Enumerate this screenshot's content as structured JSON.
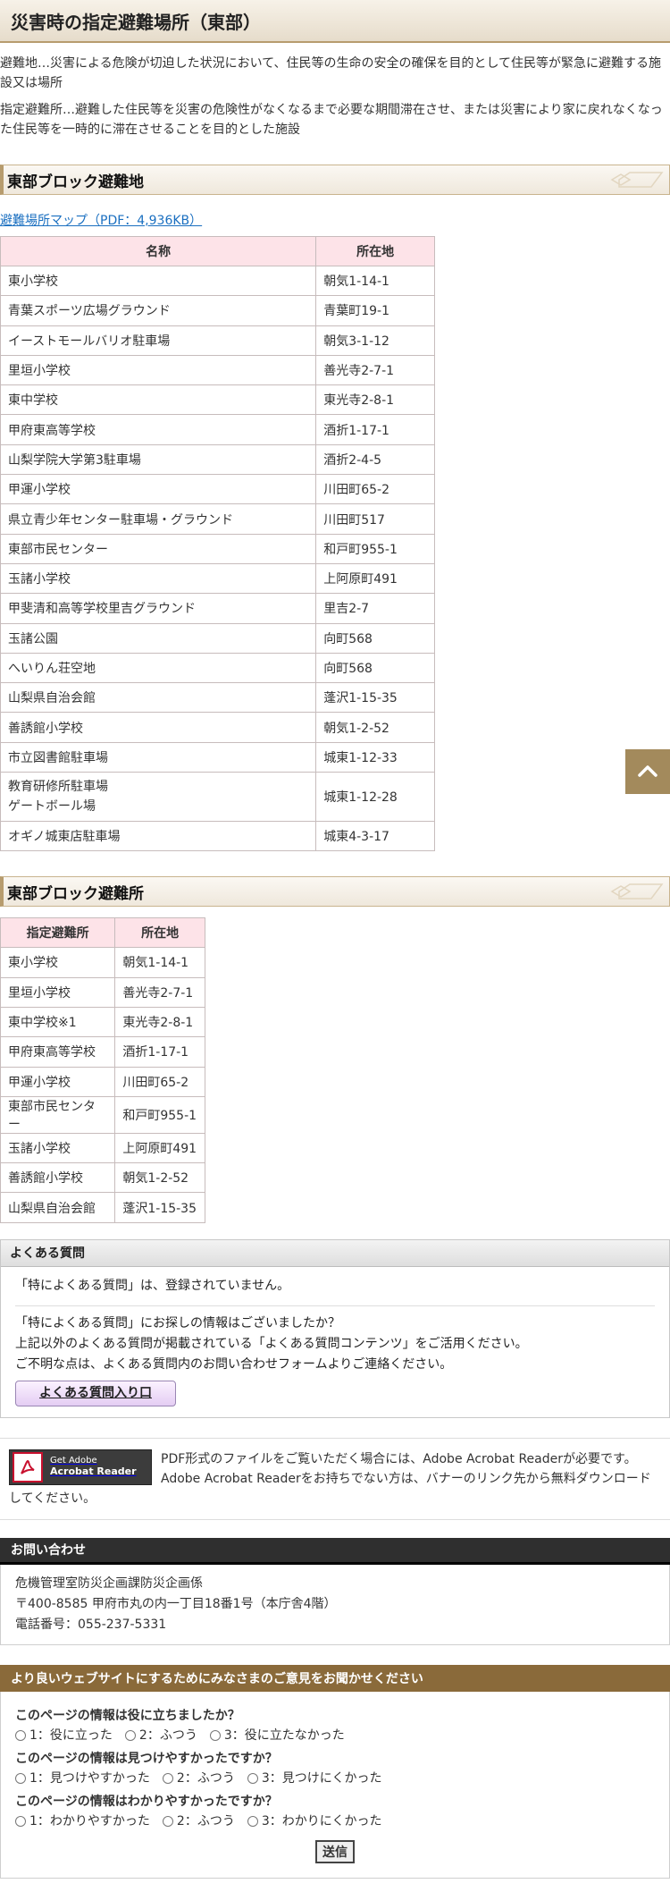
{
  "page": {
    "title": "災害時の指定避難場所（東部）",
    "intro": [
      "避難地…災害による危険が切迫した状況において、住民等の生命の安全の確保を目的として住民等が緊急に避難する施設又は場所",
      "指定避難所…避難した住民等を災害の危険性がなくなるまで必要な期間滞在させ、または災害により家に戻れなくなった住民等を一時的に滞在させることを目的とした施設"
    ]
  },
  "section1": {
    "heading": "東部ブロック避難地",
    "map_link": "避難場所マップ（PDF：4,936KB）",
    "headers": [
      "名称",
      "所在地"
    ],
    "rows": [
      [
        "東小学校",
        "朝気1-14-1"
      ],
      [
        "青葉スポーツ広場グラウンド",
        "青葉町19-1"
      ],
      [
        "イーストモールバリオ駐車場",
        "朝気3-1-12"
      ],
      [
        "里垣小学校",
        "善光寺2-7-1"
      ],
      [
        "東中学校",
        "東光寺2-8-1"
      ],
      [
        "甲府東高等学校",
        "酒折1-17-1"
      ],
      [
        "山梨学院大学第3駐車場",
        "酒折2-4-5"
      ],
      [
        "甲運小学校",
        "川田町65-2"
      ],
      [
        "県立青少年センター駐車場・グラウンド",
        "川田町517"
      ],
      [
        "東部市民センター",
        "和戸町955-1"
      ],
      [
        "玉諸小学校",
        "上阿原町491"
      ],
      [
        "甲斐清和高等学校里吉グラウンド",
        "里吉2-7"
      ],
      [
        "玉諸公園",
        "向町568"
      ],
      [
        "へいりん荘空地",
        "向町568"
      ],
      [
        "山梨県自治会館",
        "蓬沢1-15-35"
      ],
      [
        "善誘館小学校",
        "朝気1-2-52"
      ],
      [
        "市立図書館駐車場",
        "城東1-12-33"
      ],
      [
        "教育研修所駐車場\nゲートボール場",
        "城東1-12-28"
      ],
      [
        "オギノ城東店駐車場",
        "城東4-3-17"
      ]
    ]
  },
  "section2": {
    "heading": "東部ブロック避難所",
    "headers": [
      "指定避難所",
      "所在地"
    ],
    "rows": [
      [
        "東小学校",
        "朝気1-14-1"
      ],
      [
        "里垣小学校",
        "善光寺2-7-1"
      ],
      [
        "東中学校※1",
        "東光寺2-8-1"
      ],
      [
        "甲府東高等学校",
        "酒折1-17-1"
      ],
      [
        "甲運小学校",
        "川田町65-2"
      ],
      [
        "東部市民センター",
        "和戸町955-1"
      ],
      [
        "玉諸小学校",
        "上阿原町491"
      ],
      [
        "善誘館小学校",
        "朝気1-2-52"
      ],
      [
        "山梨県自治会館",
        "蓬沢1-15-35"
      ]
    ]
  },
  "faq": {
    "heading": "よくある質問",
    "none_text": "「特によくある質問」は、登録されていません。",
    "lines": [
      "「特によくある質問」にお探しの情報はございましたか？",
      "上記以外のよくある質問が掲載されている「よくある質問コンテンツ」をご活用ください。",
      "ご不明な点は、よくある質問内のお問い合わせフォームよりご連絡ください。"
    ],
    "button": "よくある質問入り口"
  },
  "acrobat": {
    "badge_line1": "Get Adobe",
    "badge_line2": "Acrobat Reader",
    "text": "PDF形式のファイルをご覧いただく場合には、Adobe Acrobat Readerが必要です。Adobe Acrobat Readerをお持ちでない方は、バナーのリンク先から無料ダウンロードしてください。"
  },
  "contact": {
    "heading": "お問い合わせ",
    "lines": [
      "危機管理室防災企画課防災企画係",
      "〒400-8585 甲府市丸の内一丁目18番1号（本庁舎4階）",
      "電話番号：055-237-5331"
    ]
  },
  "feedback": {
    "heading": "より良いウェブサイトにするためにみなさまのご意見をお聞かせください",
    "questions": [
      {
        "q": "このページの情報は役に立ちましたか？",
        "options": [
          "1：役に立った",
          "2：ふつう",
          "3：役に立たなかった"
        ]
      },
      {
        "q": "このページの情報は見つけやすかったですか？",
        "options": [
          "1：見つけやすかった",
          "2：ふつう",
          "3：見つけにくかった"
        ]
      },
      {
        "q": "このページの情報はわかりやすかったですか？",
        "options": [
          "1：わかりやすかった",
          "2：ふつう",
          "3：わかりにくかった"
        ]
      }
    ],
    "submit": "送信"
  },
  "colors": {
    "table_header": "#fde3e8",
    "section_border": "#b79c6e",
    "feedback_header": "#8a6a3a",
    "link": "#1a6fc0"
  },
  "icons": {
    "page_top": "chevron-up-icon",
    "acrobat": "adobe-acrobat-icon"
  }
}
